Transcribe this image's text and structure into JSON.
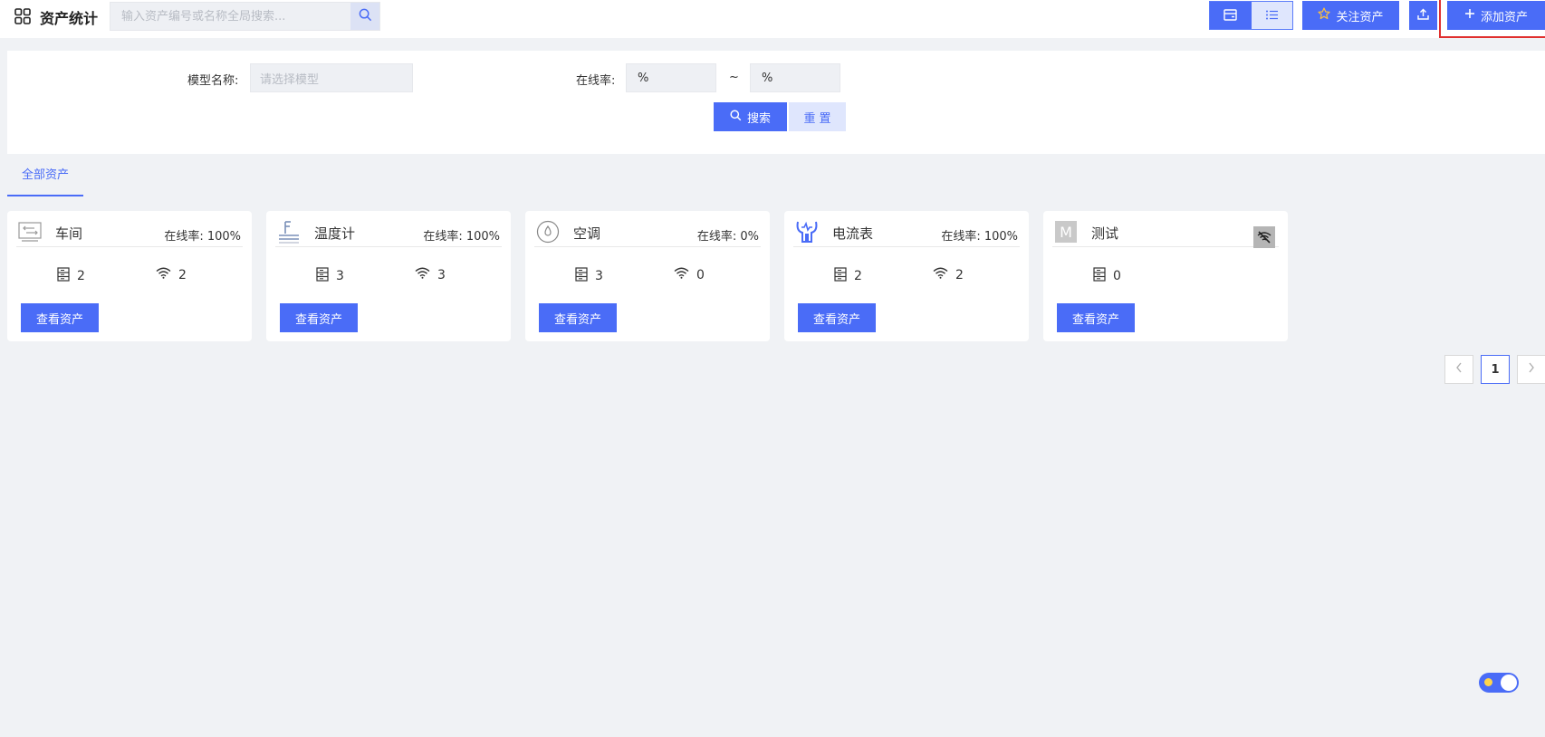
{
  "header": {
    "title": "资产统计",
    "search_placeholder": "输入资产编号或名称全局搜索...",
    "follow_label": "关注资产",
    "add_label": "添加资产"
  },
  "filter": {
    "model_label": "模型名称:",
    "model_placeholder": "请选择模型",
    "online_label": "在线率:",
    "rate_from": "%",
    "rate_to": "%",
    "tilde": "~",
    "search_label": "搜索",
    "reset_label": "重置"
  },
  "tabs": [
    {
      "label": "全部资产"
    }
  ],
  "cards": [
    {
      "name": "车间",
      "rate": "在线率: 100%",
      "device_count": "2",
      "online_count": "2",
      "button": "查看资产",
      "icon": "workshop-icon"
    },
    {
      "name": "温度计",
      "rate": "在线率: 100%",
      "device_count": "3",
      "online_count": "3",
      "button": "查看资产",
      "icon": "thermometer-icon"
    },
    {
      "name": "空调",
      "rate": "在线率: 0%",
      "device_count": "3",
      "online_count": "0",
      "button": "查看资产",
      "icon": "air-conditioner-icon"
    },
    {
      "name": "电流表",
      "rate": "在线率: 100%",
      "device_count": "2",
      "online_count": "2",
      "button": "查看资产",
      "icon": "ammeter-icon"
    },
    {
      "name": "测试",
      "rate": "",
      "device_count": "0",
      "online_count": "",
      "button": "查看资产",
      "icon": "m-letter-icon",
      "badge_letter": "M"
    }
  ],
  "pagination": {
    "current": "1"
  },
  "colors": {
    "primary": "#4a6cf7",
    "background": "#f0f2f5",
    "highlight_frame": "#e0302f"
  }
}
